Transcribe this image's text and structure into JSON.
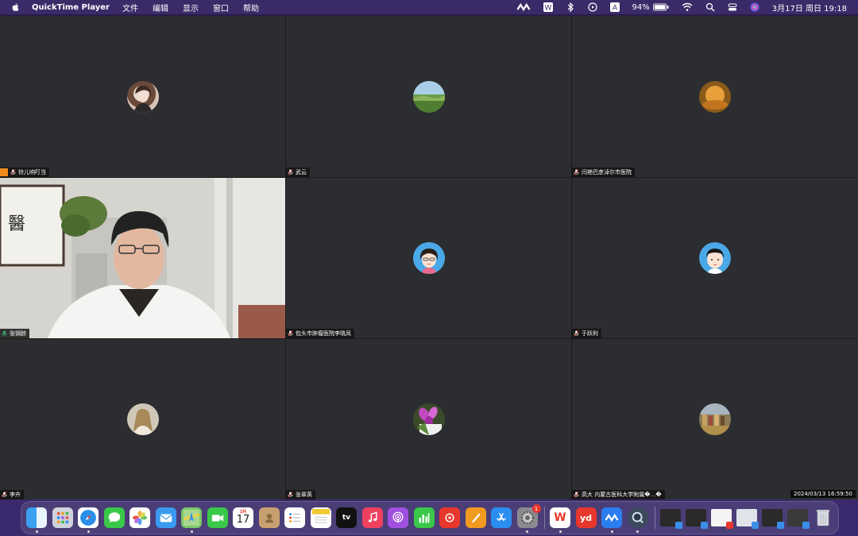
{
  "menubar": {
    "app_name": "QuickTime Player",
    "menus": [
      "文件",
      "编辑",
      "显示",
      "窗口",
      "帮助"
    ],
    "battery": "94%",
    "datetime": "3月17日 周日  19:18"
  },
  "tiles": [
    {
      "name": "铃儿响叮当",
      "host": true
    },
    {
      "name": "武云",
      "host": false
    },
    {
      "name": "闫艳巴彦淖尔市医院",
      "host": false
    },
    {
      "name": "张钢龄",
      "host": false
    },
    {
      "name": "包头市肿瘤医院李晓凤",
      "host": false
    },
    {
      "name": "于跃利",
      "host": false
    },
    {
      "name": "李卉",
      "host": false
    },
    {
      "name": "张翠英",
      "host": false
    },
    {
      "name": "高大 内蒙古医科大学附属�…�",
      "host": false
    }
  ],
  "timestamp": "2024/03/13 16:59:50",
  "dock": {
    "calendar_month": "3月",
    "calendar_day": "17",
    "settings_badge": "1",
    "tv_label": "tv",
    "yd_label": "yd",
    "wps_label": "W"
  },
  "colors": {
    "tile_bg": "#2c2d30",
    "active_border": "#3bbd78",
    "host_badge": "#f08a1c",
    "menubar_bg": "#3a2a68"
  }
}
